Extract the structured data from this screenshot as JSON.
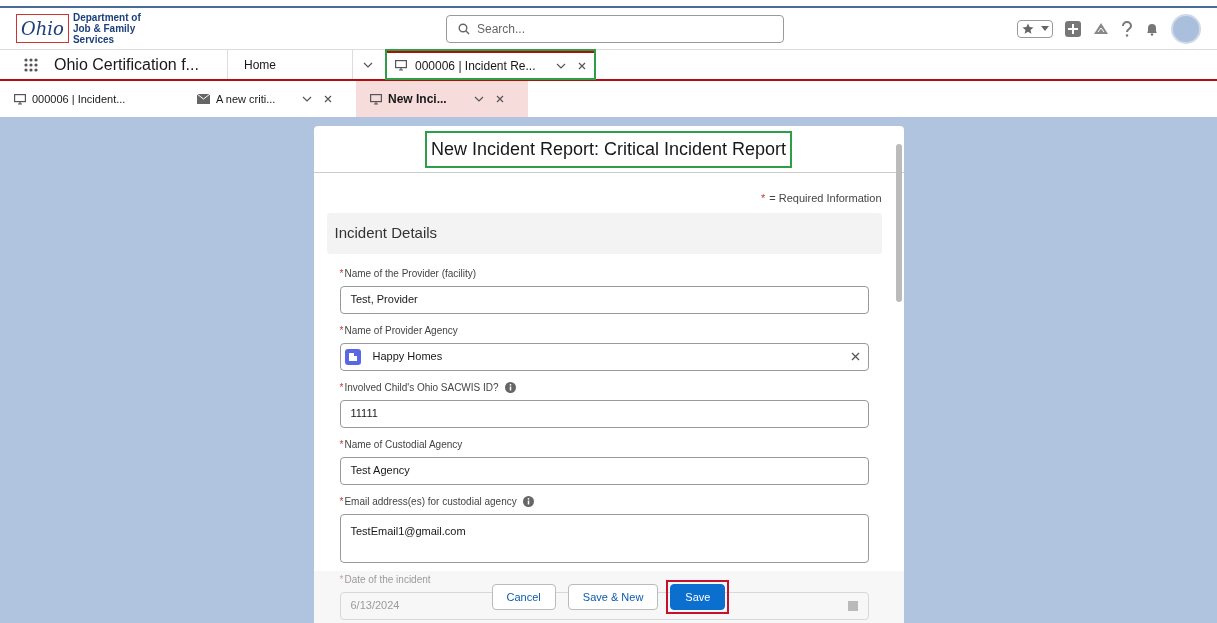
{
  "header": {
    "logo_word": "Ohio",
    "logo_text": [
      "Department of",
      "Job & Family",
      "Services"
    ],
    "search": {
      "placeholder": "Search..."
    }
  },
  "nav": {
    "app_name": "Ohio Certification f...",
    "items": [
      {
        "label": "Home",
        "kind": "link",
        "selected": false,
        "highlighted": false
      },
      {
        "label": "000006 | Incident Re...",
        "kind": "tab",
        "selected": true,
        "highlighted": true
      }
    ]
  },
  "subtabs": [
    {
      "label": "000006 | Incident...",
      "kind": "record",
      "closable": false,
      "selected": false
    },
    {
      "label": "A new criti...",
      "kind": "email",
      "closable": true,
      "selected": false
    },
    {
      "label": "New Inci...",
      "kind": "record",
      "closable": true,
      "selected": true
    }
  ],
  "modal": {
    "title": "New Incident Report: Critical Incident Report",
    "title_highlighted": true,
    "required_mark": "*",
    "required_note": "= Required Information",
    "section": "Incident Details",
    "fields": [
      {
        "kind": "text",
        "required_mark": "*",
        "label": "Name of the Provider (facility)",
        "value": "Test, Provider",
        "info": false
      },
      {
        "kind": "lookup",
        "required_mark": "*",
        "label": "Name of Provider Agency",
        "value": "Happy Homes",
        "info": false
      },
      {
        "kind": "text",
        "required_mark": "*",
        "label": "Involved Child's Ohio SACWIS ID?",
        "value": "11111",
        "info": true
      },
      {
        "kind": "text",
        "required_mark": "*",
        "label": "Name of Custodial Agency",
        "value": "Test Agency",
        "info": false
      },
      {
        "kind": "textarea",
        "required_mark": "*",
        "label": "Email address(es) for custodial agency",
        "value": "TestEmail1@gmail.com",
        "info": true
      },
      {
        "kind": "date",
        "required_mark": "*",
        "label": "Date of the incident",
        "value": "6/13/2024",
        "info": false
      }
    ],
    "buttons": [
      {
        "label": "Cancel",
        "kind": "neutral",
        "highlighted": false
      },
      {
        "label": "Save & New",
        "kind": "neutral",
        "highlighted": false
      },
      {
        "label": "Save",
        "kind": "brand",
        "highlighted": true
      }
    ]
  }
}
